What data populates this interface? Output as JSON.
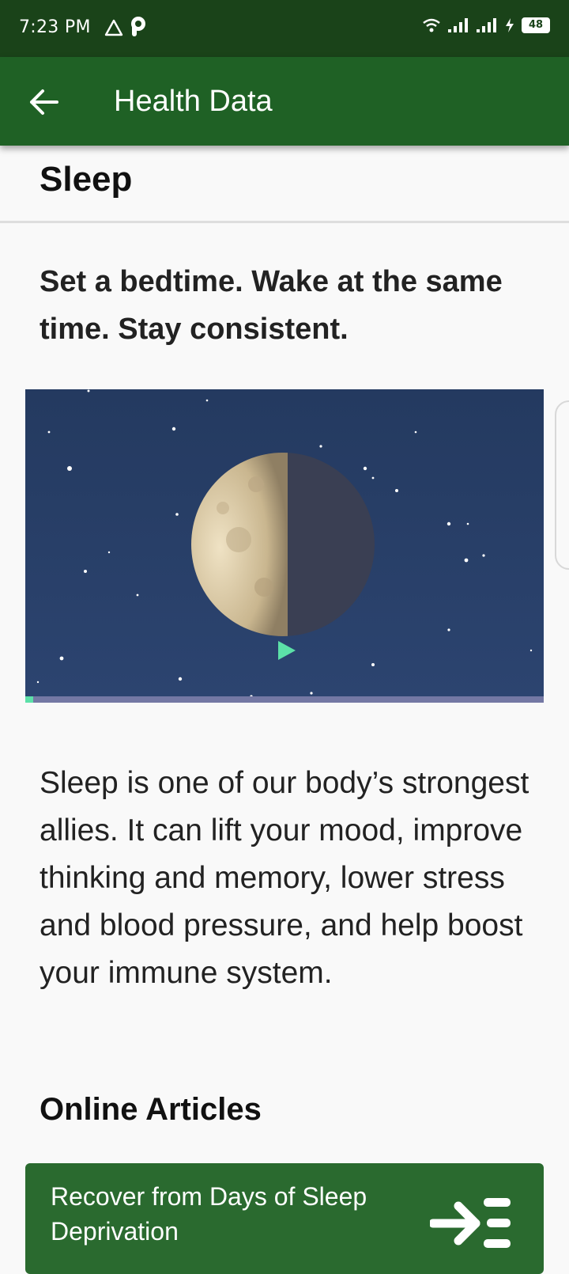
{
  "status_bar": {
    "time": "7:23 PM",
    "battery": "48"
  },
  "app_bar": {
    "title": "Health Data"
  },
  "section": {
    "title": "Sleep"
  },
  "headline": "Set a bedtime. Wake at the same time. Stay consistent.",
  "video": {
    "progress": 0.015,
    "accent_color": "#5ce0a8"
  },
  "body_text": "Sleep is one of our body’s strongest allies. It can lift your mood, improve thinking and memory, lower stress and blood pressure, and help boost your immune system.",
  "online_articles": {
    "heading": "Online Articles",
    "items": [
      {
        "title": "Recover from Days of Sleep Deprivation"
      }
    ]
  },
  "colors": {
    "status_bar": "#1a4319",
    "app_bar": "#1f6125",
    "card": "#2a6a2f"
  }
}
